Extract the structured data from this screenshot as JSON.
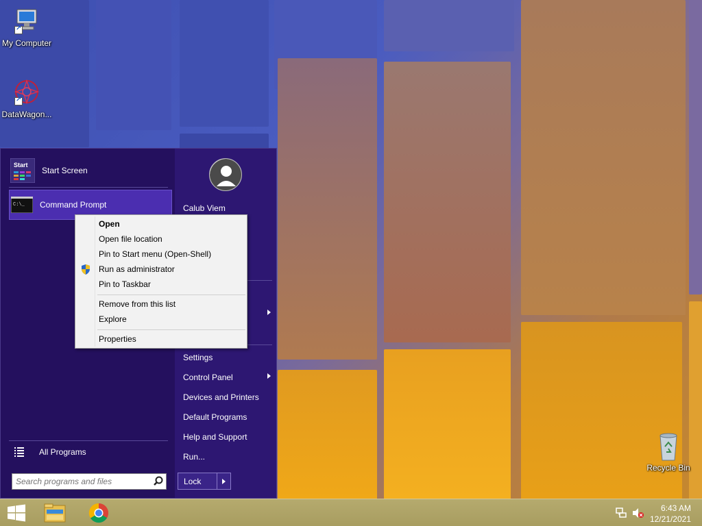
{
  "desktop": {
    "icons": [
      {
        "label": "My Computer",
        "icon": "computer-icon"
      },
      {
        "label": "DataWagon...",
        "icon": "datawagon-icon"
      },
      {
        "label": "Recycle Bin",
        "icon": "recycle-bin-icon"
      }
    ]
  },
  "start_menu": {
    "left": {
      "items": [
        {
          "label": "Start Screen",
          "icon": "start-screen-icon",
          "icon_text": "Start"
        },
        {
          "label": "Command Prompt",
          "icon": "command-prompt-icon",
          "icon_text": "C:\\_"
        }
      ],
      "all_programs": "All Programs",
      "search_placeholder": "Search programs and files"
    },
    "right": {
      "user_name": "Calub Viem",
      "items": [
        {
          "label": "Settings",
          "submenu": false
        },
        {
          "label": "Control Panel",
          "submenu": true
        },
        {
          "label": "Devices and Printers",
          "submenu": false
        },
        {
          "label": "Default Programs",
          "submenu": false
        },
        {
          "label": "Help and Support",
          "submenu": false
        },
        {
          "label": "Run...",
          "submenu": false
        }
      ],
      "lock_label": "Lock"
    }
  },
  "context_menu": {
    "items": [
      {
        "label": "Open",
        "bold": true
      },
      {
        "label": "Open file location"
      },
      {
        "label": "Pin to Start menu (Open-Shell)"
      },
      {
        "label": "Run as administrator",
        "icon": "uac-shield-icon"
      },
      {
        "label": "Pin to Taskbar"
      },
      {
        "label": "Remove from this list"
      },
      {
        "label": "Explore"
      },
      {
        "label": "Properties"
      }
    ]
  },
  "taskbar": {
    "pinned": [
      {
        "icon": "windows-start-icon"
      },
      {
        "icon": "file-explorer-icon"
      },
      {
        "icon": "chrome-icon"
      }
    ],
    "tray": {
      "icons": [
        "network-icon",
        "volume-muted-icon"
      ],
      "time": "6:43 AM",
      "date": "12/21/2021"
    }
  },
  "colors": {
    "start_menu_bg": "#24105e",
    "start_menu_right_bg": "#2d1772",
    "highlight": "#4b2eb0",
    "taskbar": "#b5aa6e"
  }
}
